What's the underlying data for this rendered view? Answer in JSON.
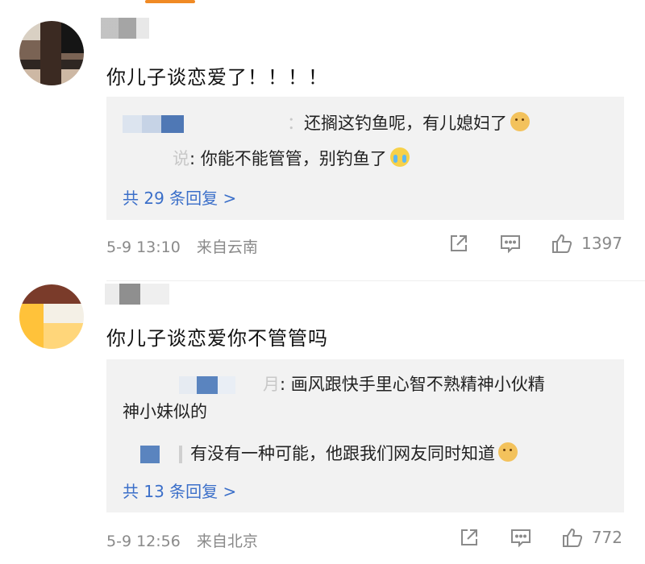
{
  "comments": [
    {
      "text": "你儿子谈恋爱了！！！！",
      "replies": [
        {
          "name_tail": "：",
          "text": "还搁这钓鱼呢，有儿媳妇了",
          "emoji": "doge-emoji"
        },
        {
          "name_tail": "说",
          "text": ": 你能不能管管，别钓鱼了",
          "emoji": "crying-emoji"
        }
      ],
      "more_replies": "共 29 条回复 >",
      "date": "5-9 13:10",
      "location": "来自云南",
      "likes": "1397"
    },
    {
      "text": "你儿子谈恋爱你不管管吗",
      "replies": [
        {
          "name_tail": "月",
          "text": ": 画风跟快手里心智不熟精神小伙精",
          "text2": "神小妹似的"
        },
        {
          "name_tail": "",
          "text": "有没有一种可能，他跟我们网友同时知道",
          "emoji": "doge-emoji"
        }
      ],
      "more_replies": "共 13 条回复 >",
      "date": "5-9 12:56",
      "location": "来自北京",
      "likes": "772"
    }
  ],
  "icons": {
    "share": "share-icon",
    "comment": "comment-icon",
    "like": "thumbs-up-icon"
  },
  "colors": {
    "accent": "#f08a24",
    "link": "#3b6fc9",
    "reply_bg": "#f2f2f2"
  }
}
